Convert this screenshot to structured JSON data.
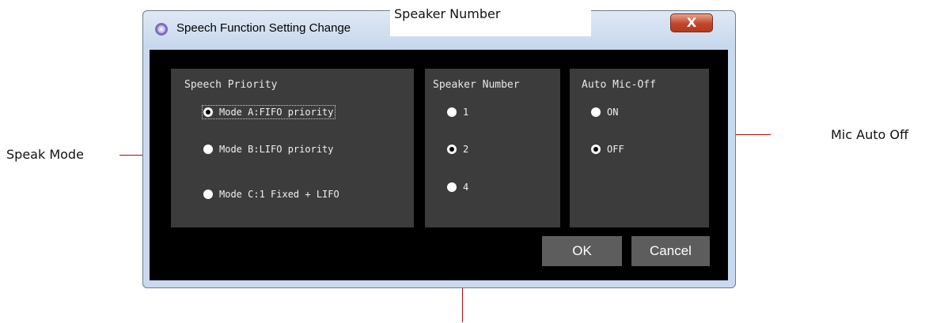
{
  "window": {
    "title": "Speech Function Setting Change",
    "close_label": "X"
  },
  "panels": {
    "speech_priority": {
      "title": "Speech Priority",
      "options": [
        {
          "label": "Mode A:FIFO priority",
          "checked": true
        },
        {
          "label": "Mode B:LIFO priority",
          "checked": false
        },
        {
          "label": "Mode C:1 Fixed + LIFO",
          "checked": false
        }
      ]
    },
    "speaker_number": {
      "title": "Speaker Number",
      "options": [
        {
          "label": "1",
          "checked": false
        },
        {
          "label": "2",
          "checked": true
        },
        {
          "label": "4",
          "checked": false
        }
      ]
    },
    "auto_mic_off": {
      "title": "Auto Mic-Off",
      "options": [
        {
          "label": "ON",
          "checked": false
        },
        {
          "label": "OFF",
          "checked": true
        }
      ]
    }
  },
  "buttons": {
    "ok": "OK",
    "cancel": "Cancel"
  },
  "annotations": {
    "top": "Speaker Number",
    "left": "Speak Mode",
    "right": "Mic Auto Off"
  }
}
